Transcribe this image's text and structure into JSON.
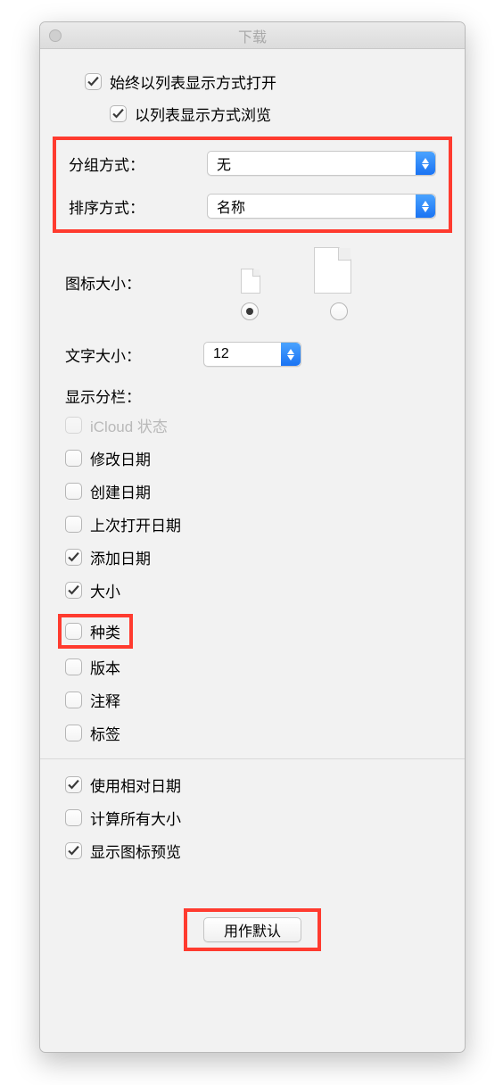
{
  "window": {
    "title": "下载"
  },
  "header": {
    "always_list": "始终以列表显示方式打开",
    "browse_list": "以列表显示方式浏览"
  },
  "grouping": {
    "group_by_label": "分组方式：",
    "group_by_value": "无",
    "sort_by_label": "排序方式：",
    "sort_by_value": "名称"
  },
  "icon_size": {
    "label": "图标大小："
  },
  "text_size": {
    "label": "文字大小：",
    "value": "12"
  },
  "columns": {
    "title": "显示分栏：",
    "items": [
      {
        "label": "iCloud 状态",
        "checked": false,
        "disabled": true
      },
      {
        "label": "修改日期",
        "checked": false
      },
      {
        "label": "创建日期",
        "checked": false
      },
      {
        "label": "上次打开日期",
        "checked": false
      },
      {
        "label": "添加日期",
        "checked": true
      },
      {
        "label": "大小",
        "checked": true
      },
      {
        "label": "种类",
        "checked": false,
        "highlight": true
      },
      {
        "label": "版本",
        "checked": false
      },
      {
        "label": "注释",
        "checked": false
      },
      {
        "label": "标签",
        "checked": false
      }
    ]
  },
  "footer": {
    "relative_dates": "使用相对日期",
    "calc_all_sizes": "计算所有大小",
    "show_icon_preview": "显示图标预览",
    "default_button": "用作默认"
  }
}
